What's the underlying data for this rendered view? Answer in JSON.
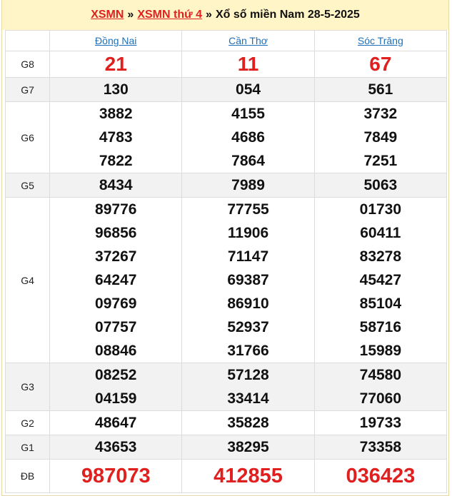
{
  "breadcrumb": {
    "link1": "XSMN",
    "sep1": "»",
    "link2": "XSMN thứ 4",
    "sep2": "»",
    "title": "Xổ số miền Nam 28-5-2025"
  },
  "provinces": [
    "Đồng Nai",
    "Cần Thơ",
    "Sóc Trăng"
  ],
  "prizes": [
    {
      "label": "G8",
      "values": [
        [
          "21"
        ],
        [
          "11"
        ],
        [
          "67"
        ]
      ]
    },
    {
      "label": "G7",
      "values": [
        [
          "130"
        ],
        [
          "054"
        ],
        [
          "561"
        ]
      ]
    },
    {
      "label": "G6",
      "values": [
        [
          "3882",
          "4783",
          "7822"
        ],
        [
          "4155",
          "4686",
          "7864"
        ],
        [
          "3732",
          "7849",
          "7251"
        ]
      ]
    },
    {
      "label": "G5",
      "values": [
        [
          "8434"
        ],
        [
          "7989"
        ],
        [
          "5063"
        ]
      ]
    },
    {
      "label": "G4",
      "values": [
        [
          "89776",
          "96856",
          "37267",
          "64247",
          "09769",
          "07757",
          "08846"
        ],
        [
          "77755",
          "11906",
          "71147",
          "69387",
          "86910",
          "52937",
          "31766"
        ],
        [
          "01730",
          "60411",
          "83278",
          "45427",
          "85104",
          "58716",
          "15989"
        ]
      ]
    },
    {
      "label": "G3",
      "values": [
        [
          "08252",
          "04159"
        ],
        [
          "57128",
          "33414"
        ],
        [
          "74580",
          "77060"
        ]
      ]
    },
    {
      "label": "G2",
      "values": [
        [
          "48647"
        ],
        [
          "35828"
        ],
        [
          "19733"
        ]
      ]
    },
    {
      "label": "G1",
      "values": [
        [
          "43653"
        ],
        [
          "38295"
        ],
        [
          "73358"
        ]
      ]
    },
    {
      "label": "ĐB",
      "values": [
        [
          "987073"
        ],
        [
          "412855"
        ],
        [
          "036423"
        ]
      ]
    }
  ],
  "colors": {
    "accent_red": "#e0201f",
    "link_blue": "#1e6fb8",
    "header_bg": "#fff5c7",
    "row_shade": "#f2f2f2"
  }
}
